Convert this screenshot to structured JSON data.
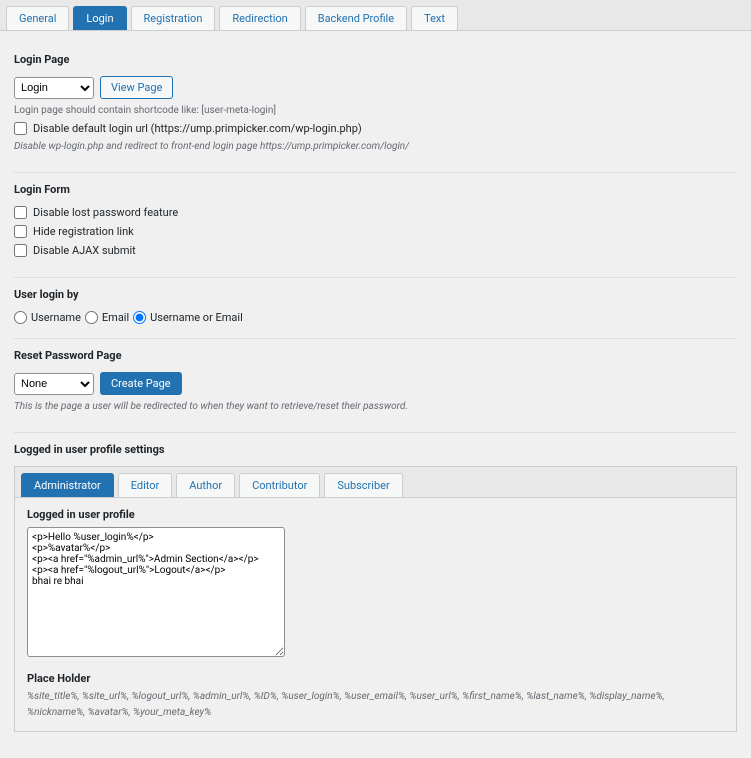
{
  "tabs": {
    "items": [
      "General",
      "Login",
      "Registration",
      "Redirection",
      "Backend Profile",
      "Text"
    ],
    "activeIndex": 1
  },
  "loginPage": {
    "heading": "Login Page",
    "selectValue": "Login",
    "viewBtn": "View Page",
    "hint": "Login page should contain shortcode like: [user-meta-login]",
    "disableDefaultLabel": "Disable default login url (https://ump.primpicker.com/wp-login.php)",
    "disableDefaultDesc": "Disable wp-login.php and redirect to front-end login page https://ump.primpicker.com/login/"
  },
  "loginForm": {
    "heading": "Login Form",
    "lostPwd": "Disable lost password feature",
    "hideReg": "Hide registration link",
    "disableAjax": "Disable AJAX submit"
  },
  "loginBy": {
    "heading": "User login by",
    "username": "Username",
    "email": "Email",
    "both": "Username or Email"
  },
  "resetPwd": {
    "heading": "Reset Password Page",
    "selectValue": "None",
    "createBtn": "Create Page",
    "desc": "This is the page a user will be redirected to when they want to retrieve/reset their password."
  },
  "profileSettings": {
    "heading": "Logged in user profile settings",
    "roles": [
      "Administrator",
      "Editor",
      "Author",
      "Contributor",
      "Subscriber"
    ],
    "activeRoleIndex": 0,
    "loggedInProfileLabel": "Logged in user profile",
    "textareaValue": "<p>Hello %user_login%</p>\n<p>%avatar%</p>\n<p><a href=\"%admin_url%\">Admin Section</a></p>\n<p><a href=\"%logout_url%\">Logout</a></p>\nbhai re bhai",
    "placeHolderLabel": "Place Holder",
    "placeholders": "%site_title%, %site_url%, %logout_url%, %admin_url%, %ID%, %user_login%, %user_email%, %user_url%, %first_name%, %last_name%, %display_name%, %nickname%, %avatar%, %your_meta_key%"
  }
}
